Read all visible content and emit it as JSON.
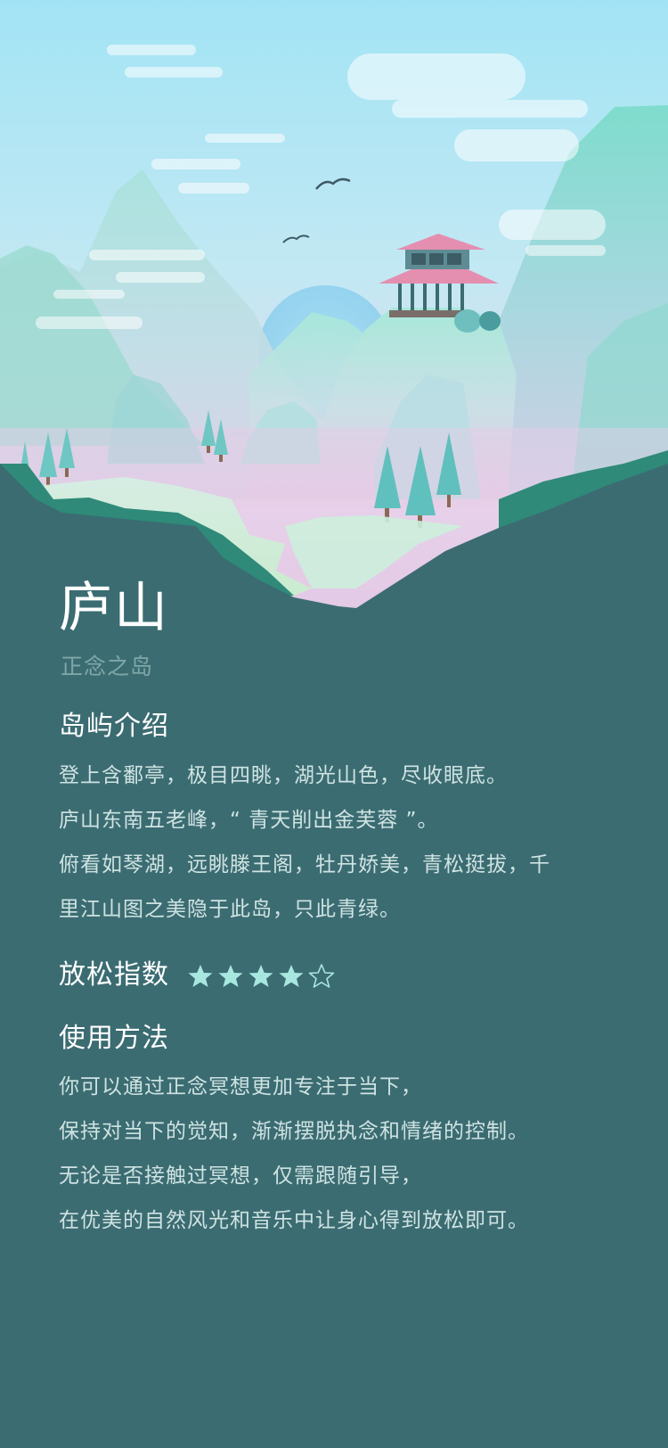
{
  "header": {
    "title": "庐山",
    "subtitle": "正念之岛"
  },
  "intro": {
    "heading": "岛屿介绍",
    "lines": [
      "登上含鄱亭，极目四眺，湖光山色，尽收眼底。",
      "庐山东南五老峰，“ 青天削出金芙蓉 ”。",
      "俯看如琴湖，远眺滕王阁，牡丹娇美，青松挺拔，千",
      "里江山图之美隐于此岛，只此青绿。"
    ]
  },
  "relax": {
    "label": "放松指数",
    "rating": 4,
    "max": 5,
    "star_color": "#a8e6e0"
  },
  "usage": {
    "heading": "使用方法",
    "lines": [
      "你可以通过正念冥想更加专注于当下，",
      "保持对当下的觉知，渐渐摆脱执念和情绪的控制。",
      "无论是否接触过冥想，仅需跟随引导，",
      "在优美的自然风光和音乐中让身心得到放松即可。"
    ]
  },
  "colors": {
    "background": "#3b6c72",
    "sky_top": "#a2e4f5",
    "pagoda_roof": "#e48fb0",
    "subtitle_text": "#7fa7a8"
  },
  "icons": {
    "rating": "star-icon"
  }
}
